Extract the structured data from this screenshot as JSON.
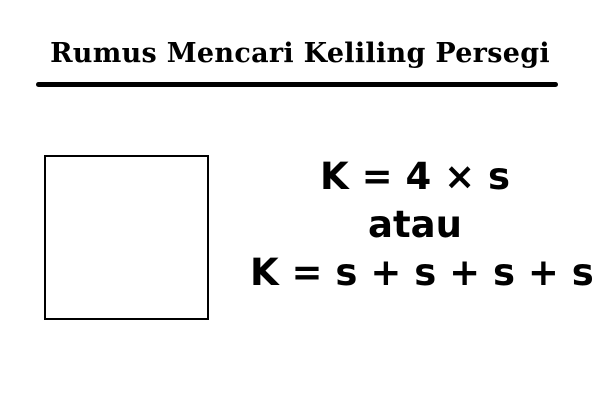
{
  "title": "Rumus Mencari Keliling Persegi",
  "formulas": {
    "primary": "K = 4 × s",
    "connector": "atau",
    "expanded": "K = s + s + s + s"
  },
  "colors": {
    "background": "#ffffff",
    "text": "#000000",
    "shape_stroke": "#000000"
  }
}
